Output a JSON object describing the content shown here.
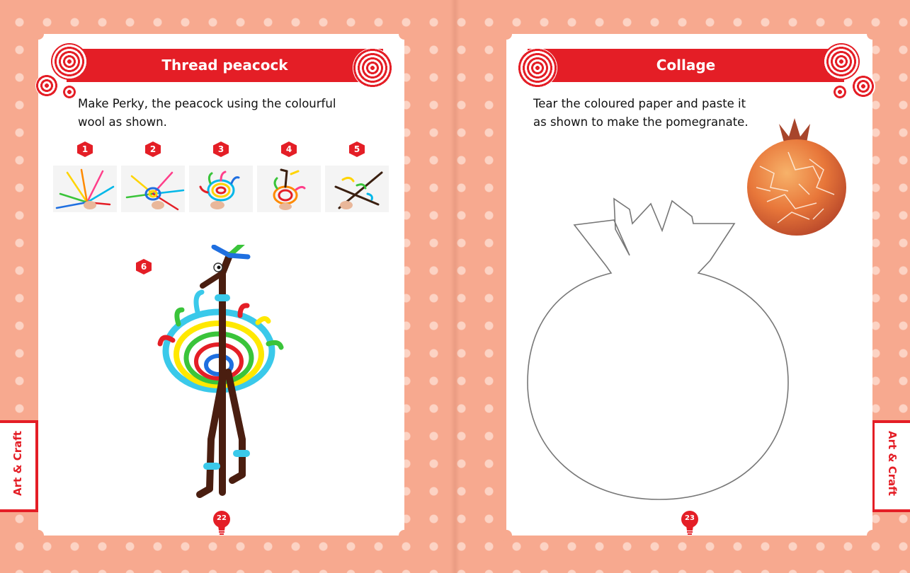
{
  "left_page": {
    "title": "Thread peacock",
    "instruction_line1": "Make Perky, the peacock using the colourful",
    "instruction_line2": "wool as shown.",
    "steps": [
      "1",
      "2",
      "3",
      "4",
      "5"
    ],
    "final_step": "6",
    "page_number": "22",
    "side_tab": "Art & Craft"
  },
  "right_page": {
    "title": "Collage",
    "instruction_line1": "Tear the coloured paper and paste it",
    "instruction_line2": "as shown to make the pomegranate.",
    "page_number": "23",
    "side_tab": "Art & Craft"
  },
  "colors": {
    "background": "#f7a98f",
    "accent_red": "#e41e26",
    "page": "#ffffff"
  }
}
